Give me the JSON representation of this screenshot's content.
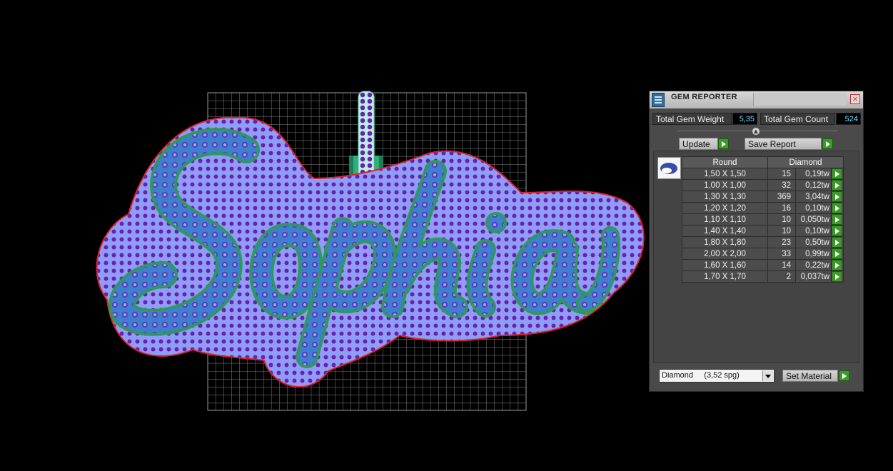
{
  "panel": {
    "title": "GEM REPORTER",
    "close_icon": "close-icon",
    "total_weight_label": "Total Gem Weight",
    "total_weight_value": "5,35",
    "total_count_label": "Total Gem Count",
    "total_count_value": "524",
    "update_label": "Update",
    "save_report_label": "Save Report",
    "table": {
      "shape_header": "Round",
      "material_header": "Diamond",
      "rows": [
        {
          "size": "1,50 X 1,50",
          "count": "15",
          "weight": "0,19tw"
        },
        {
          "size": "1,00 X 1,00",
          "count": "32",
          "weight": "0,12tw"
        },
        {
          "size": "1,30 X 1,30",
          "count": "369",
          "weight": "3,04tw"
        },
        {
          "size": "1,20 X 1,20",
          "count": "16",
          "weight": "0,10tw"
        },
        {
          "size": "1,10 X 1,10",
          "count": "10",
          "weight": "0,050tw"
        },
        {
          "size": "1,40 X 1,40",
          "count": "10",
          "weight": "0,10tw"
        },
        {
          "size": "1,80 X 1,80",
          "count": "23",
          "weight": "0,50tw"
        },
        {
          "size": "2,00 X 2,00",
          "count": "33",
          "weight": "0,99tw"
        },
        {
          "size": "1,60 X 1,60",
          "count": "14",
          "weight": "0,22tw"
        },
        {
          "size": "1,70 X 1,70",
          "count": "2",
          "weight": "0,037tw"
        }
      ]
    },
    "material_select": "Diamond     (3,52 spg)",
    "set_material_label": "Set Material"
  },
  "viewport": {
    "design_text": "Sophia",
    "colors": {
      "background": "#000000",
      "grid": "#8a8a8a",
      "outline": "#e0202a",
      "gem_fill": "#8e9df5",
      "gem_dot": "#6a1fb0",
      "letter_fill": "#3f7fd0",
      "letter_edge": "#2d9a5a",
      "bail": "#b9f0e0"
    }
  }
}
